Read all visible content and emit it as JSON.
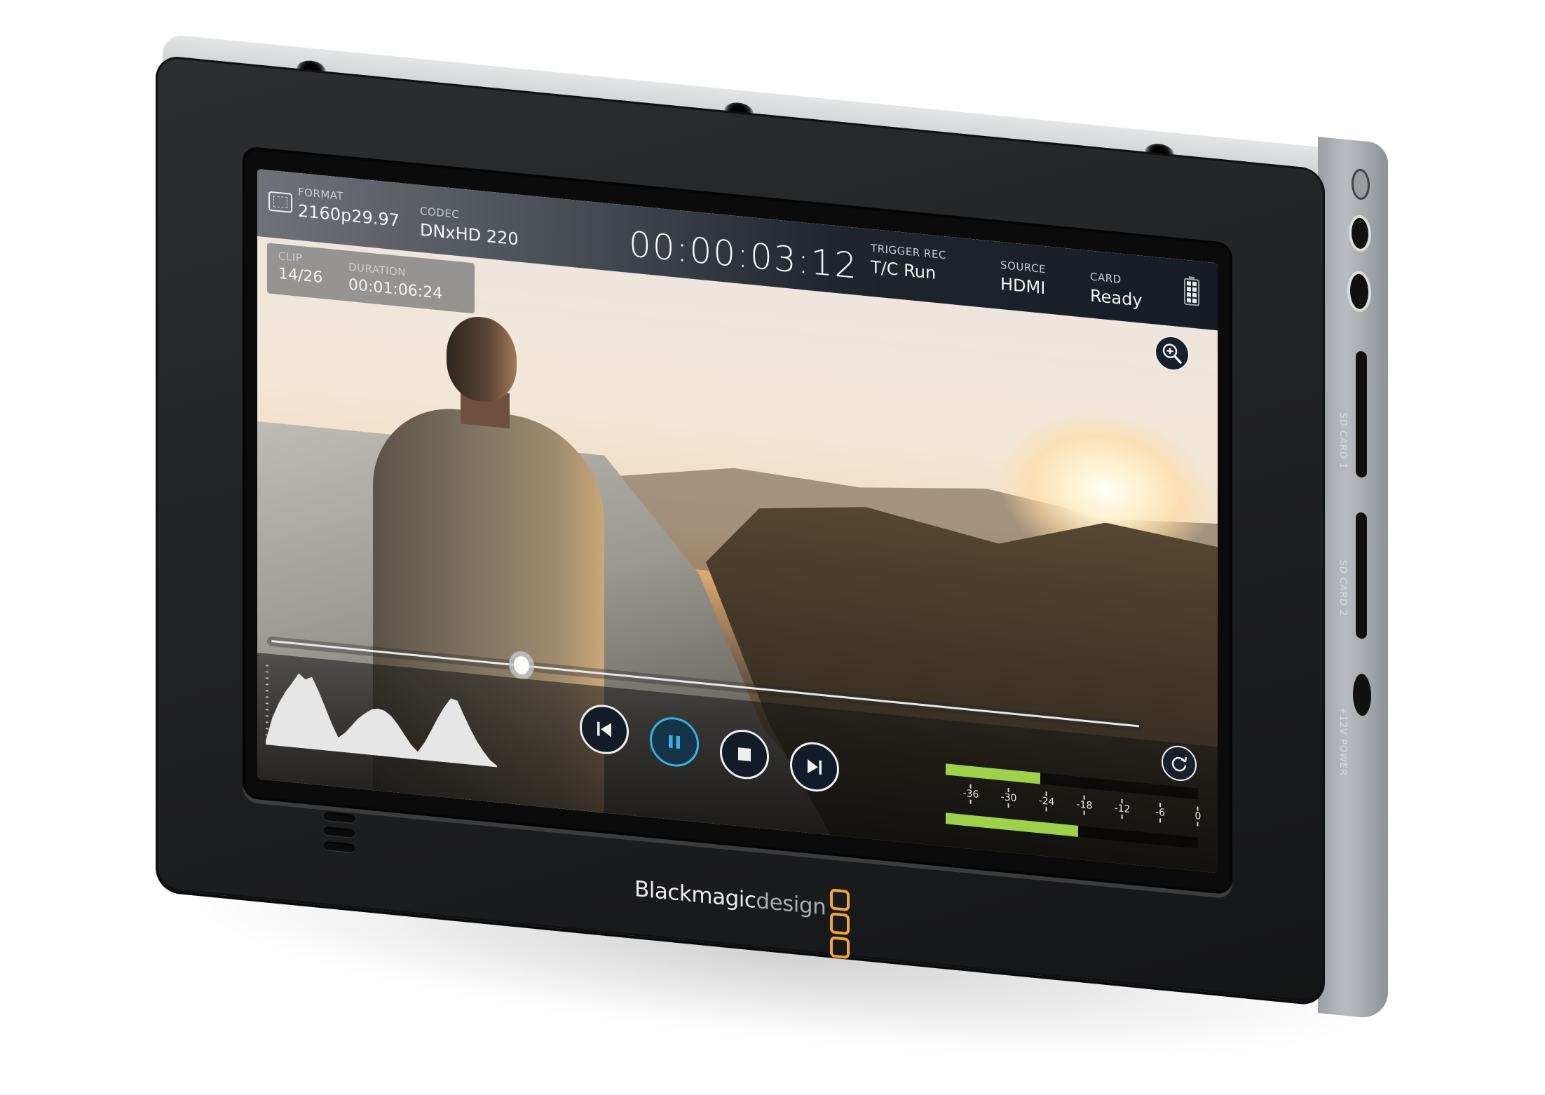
{
  "device": {
    "brand": "Blackmagicdesign",
    "brand_bold": "Blackmagic",
    "brand_light": "design",
    "side_labels": [
      "SD CARD 1",
      "SD CARD 2",
      "+12V POWER"
    ],
    "accent_color": "#f2a43a"
  },
  "topbar": {
    "frame_guide_icon": "frame-guide-icon",
    "format": {
      "label": "FORMAT",
      "value": "2160p29.97"
    },
    "codec": {
      "label": "CODEC",
      "value": "DNxHD 220"
    },
    "timecode": "00:00:03:12",
    "trigger_rec": {
      "label": "TRIGGER REC",
      "value": "T/C Run"
    },
    "source": {
      "label": "SOURCE",
      "value": "HDMI"
    },
    "card": {
      "label": "CARD",
      "value": "Ready"
    },
    "battery": {
      "icon": "battery-icon",
      "level_percent": 100
    }
  },
  "clip_info": {
    "clip": {
      "label": "CLIP",
      "value": "14/26"
    },
    "duration": {
      "label": "DURATION",
      "value": "00:01:06:24"
    }
  },
  "controls": {
    "zoom_icon": "zoom-in-icon",
    "loop_icon": "loop-icon",
    "scrubber_position_fraction": 0.29,
    "transport": [
      {
        "name": "previous-clip",
        "icon": "skip-back-icon",
        "active": false
      },
      {
        "name": "pause",
        "icon": "pause-icon",
        "active": true
      },
      {
        "name": "stop",
        "icon": "stop-icon",
        "active": false
      },
      {
        "name": "next-clip",
        "icon": "skip-forward-icon",
        "active": false
      }
    ],
    "active_color": "#35b3e6"
  },
  "audio_meters": {
    "scale_min": -40,
    "scale_max": 0,
    "ticks": [
      "-36",
      "-30",
      "-24",
      "-18",
      "-12",
      "-6",
      "0"
    ],
    "channels": [
      {
        "name": "ch1",
        "level_db": -25
      },
      {
        "name": "ch2",
        "level_db": -19
      }
    ],
    "meter_color": "#9ed24b"
  },
  "histogram": {
    "values": [
      0.05,
      0.35,
      0.55,
      0.7,
      0.82,
      0.95,
      0.88,
      0.92,
      0.75,
      0.55,
      0.35,
      0.18,
      0.25,
      0.35,
      0.45,
      0.52,
      0.58,
      0.6,
      0.58,
      0.52,
      0.42,
      0.3,
      0.18,
      0.1,
      0.22,
      0.38,
      0.55,
      0.7,
      0.82,
      0.8,
      0.62,
      0.45,
      0.3,
      0.18,
      0.08,
      0.02
    ]
  }
}
